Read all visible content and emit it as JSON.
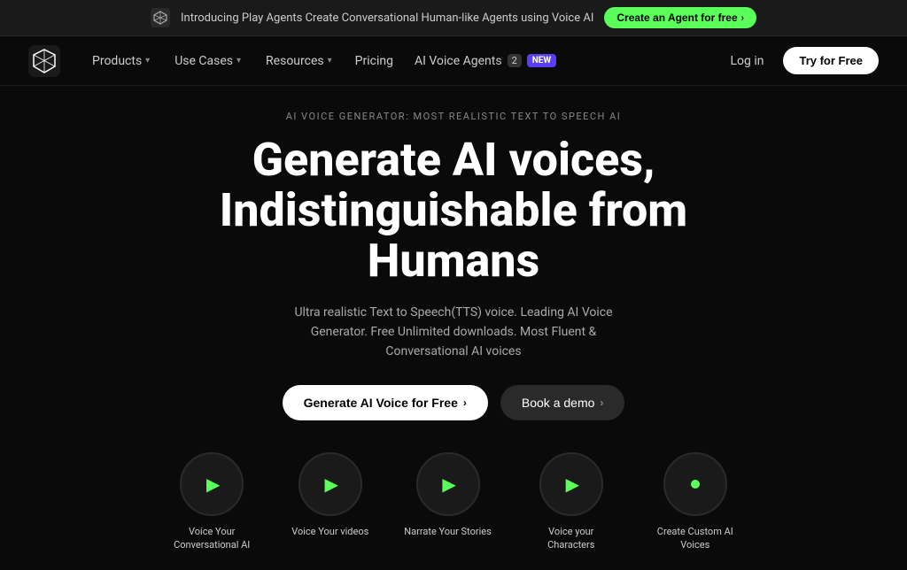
{
  "announcement": {
    "text": "Introducing Play Agents  Create Conversational Human-like Agents using Voice AI",
    "cta_label": "Create an Agent  for free",
    "cta_arrow": "›"
  },
  "navbar": {
    "products_label": "Products",
    "products_arrow": "▾",
    "use_cases_label": "Use Cases",
    "use_cases_arrow": "▾",
    "resources_label": "Resources",
    "resources_arrow": "▾",
    "pricing_label": "Pricing",
    "voice_agents_label": "AI Voice Agents",
    "voice_agents_count": "2",
    "voice_agents_new": "NEW",
    "login_label": "Log in",
    "try_label": "Try for Free"
  },
  "hero": {
    "tag": "AI VOICE GENERATOR: MOST REALISTIC TEXT TO SPEECH AI",
    "title_line1": "Generate AI voices,",
    "title_line2": "Indistinguishable from",
    "title_line3": "Humans",
    "subtitle": "Ultra realistic Text to Speech(TTS) voice. Leading AI Voice Generator. Free Unlimited downloads. Most Fluent & Conversational AI voices",
    "btn_primary": "Generate AI Voice for Free",
    "btn_primary_arrow": "›",
    "btn_secondary": "Book a demo",
    "btn_secondary_arrow": "›"
  },
  "features": [
    {
      "label": "Voice Your Conversational AI"
    },
    {
      "label": "Voice Your videos"
    },
    {
      "label": "Narrate Your Stories"
    },
    {
      "label": "Voice your Characters"
    },
    {
      "label": "Create Custom AI Voices"
    }
  ],
  "colors": {
    "green": "#5aff5a",
    "purple": "#5b3df5",
    "bg": "#0a0a0a"
  }
}
